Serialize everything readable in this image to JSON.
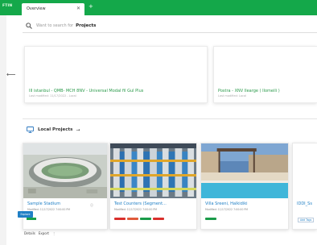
{
  "titlebar": {
    "app_badge": "FTIN",
    "tab_label": "Overview",
    "tab_close": "✕",
    "tab_add": "+",
    "accent": "#14a84a"
  },
  "search": {
    "placeholder": "Want to search for",
    "scope": "Projects"
  },
  "nav": {
    "back_icon": "arrow-left-icon"
  },
  "recent": [
    {
      "title": "III istanbul - QMB- MCH 8NV - Universal Modal fil Gul Plus",
      "subtitle": "Last modified: 11/17/2022 - Local"
    },
    {
      "title": "Postra - XNV Ilearge ( Ilomeili )",
      "subtitle": "Last modified: Local"
    }
  ],
  "local_section": {
    "label": "Local Projects",
    "arrow": "→"
  },
  "projects": [
    {
      "title": "Sample Stadium",
      "modified": "Modified: 11/17/2022 7:00:00 PM",
      "info": "ⓘ",
      "open_label": "Explore",
      "actions": [
        "Details",
        "Export",
        "⋮"
      ]
    },
    {
      "title": "Test Counters (Segment...",
      "modified": "Modified: 11/17/2022 7:00:00 PM",
      "progress_colors": [
        "#d9302c",
        "#e05a3a",
        "#1a9b49",
        "#d9302c"
      ]
    },
    {
      "title": "Villa Sreeni, Halkidiki",
      "modified": "Modified: 11/17/2022 7:00:00 PM",
      "progress_colors": [
        "#1a9b49"
      ]
    },
    {
      "title": "IDDI_Ss",
      "button": "Add Tags"
    }
  ]
}
